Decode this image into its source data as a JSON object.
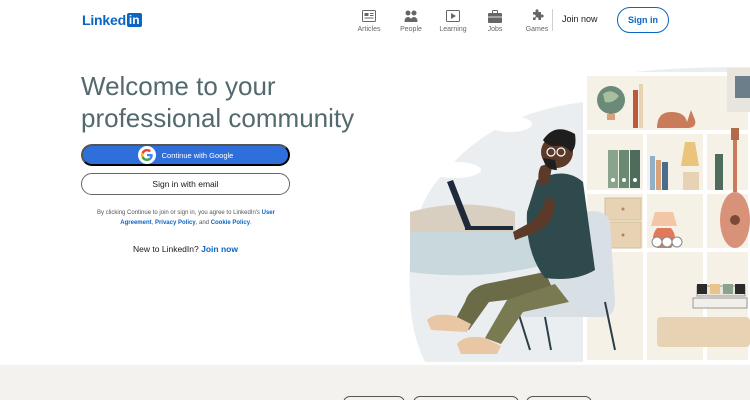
{
  "brand": {
    "logo_text": "Linked",
    "logo_box": "in",
    "color": "#0a66c2"
  },
  "nav": {
    "items": [
      {
        "label": "Articles",
        "icon": "articles-icon"
      },
      {
        "label": "People",
        "icon": "people-icon"
      },
      {
        "label": "Learning",
        "icon": "learning-icon"
      },
      {
        "label": "Jobs",
        "icon": "jobs-icon"
      },
      {
        "label": "Games",
        "icon": "games-icon"
      }
    ],
    "join_now": "Join now",
    "sign_in": "Sign in"
  },
  "hero": {
    "title": "Welcome to your professional community",
    "google_button": "Continue with Google",
    "email_button": "Sign in with email",
    "legal": {
      "prefix": "By clicking Continue to join or sign in, you agree to LinkedIn's ",
      "user_agreement": "User Agreement",
      "sep1": ", ",
      "privacy_policy": "Privacy Policy",
      "sep2": ", and ",
      "cookie_policy": "Cookie Policy",
      "suffix": "."
    },
    "new_to": "New to LinkedIn?",
    "join_now": "Join now"
  },
  "colors": {
    "accent": "#0a66c2",
    "google_button": "#2f6fdb",
    "title": "#526a6e",
    "footer": "#f3f2ef"
  }
}
